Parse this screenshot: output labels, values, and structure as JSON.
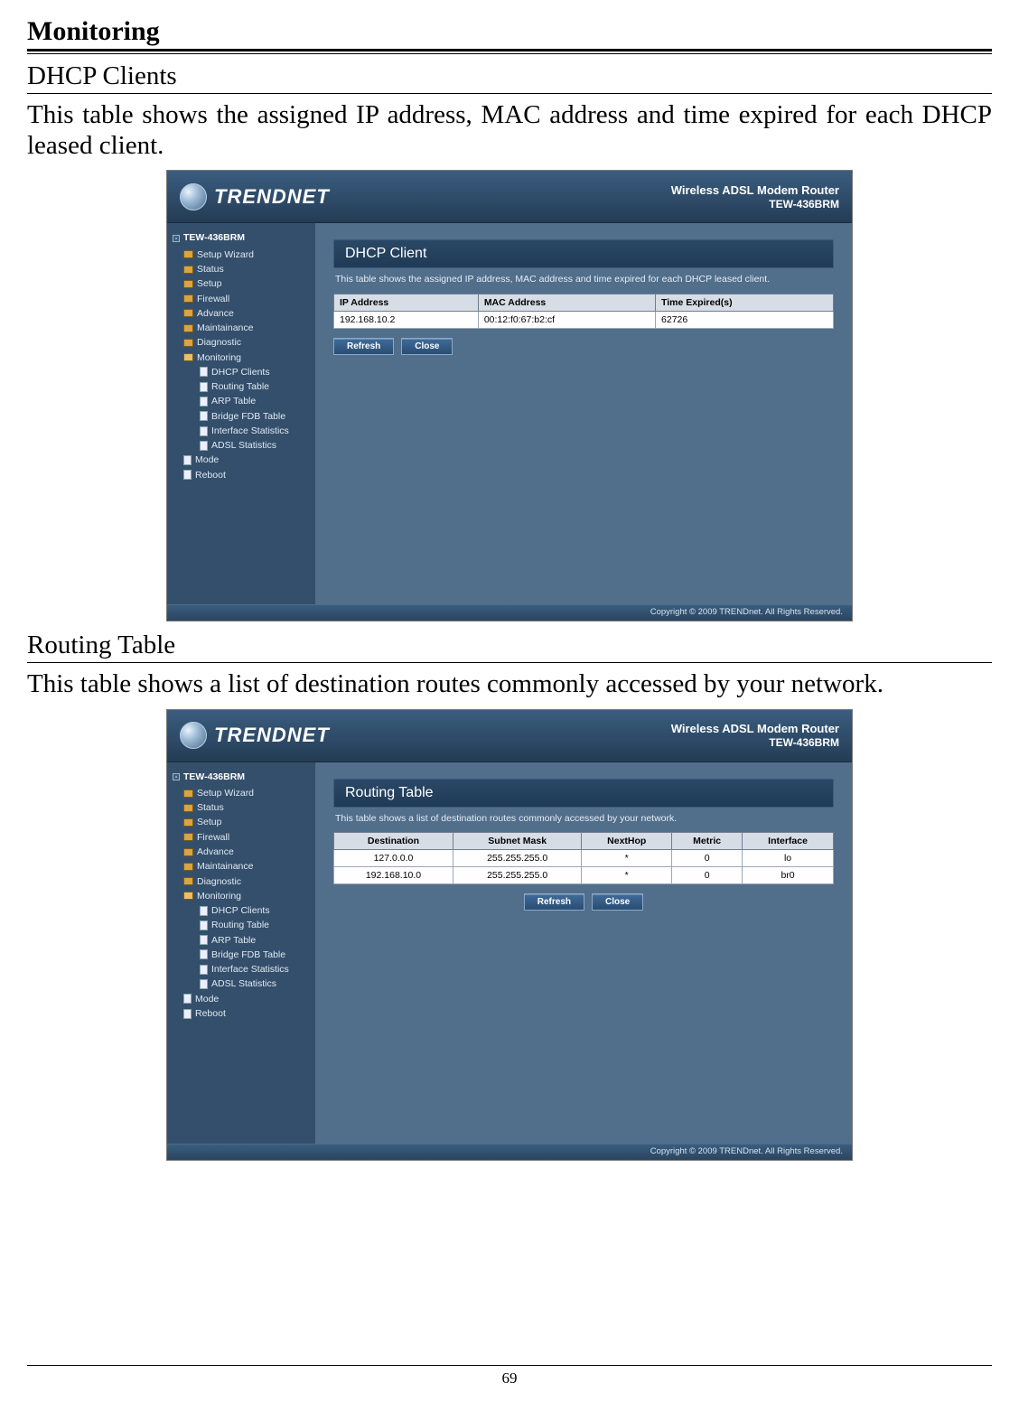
{
  "page": {
    "h1": "Monitoring",
    "section1_title": "DHCP Clients",
    "section1_body": "This table shows the assigned IP address, MAC address and time expired for each DHCP leased client.",
    "section2_title": "Routing Table",
    "section2_body": "This table shows a list of destination routes commonly accessed by your network.",
    "page_number": "69"
  },
  "router": {
    "brand": "TRENDNET",
    "product_line1": "Wireless ADSL Modem Router",
    "product_line2": "TEW-436BRM",
    "copyright": "Copyright © 2009 TRENDnet. All Rights Reserved.",
    "nav": {
      "root": "TEW-436BRM",
      "items": [
        "Setup Wizard",
        "Status",
        "Setup",
        "Firewall",
        "Advance",
        "Maintainance",
        "Diagnostic",
        "Monitoring"
      ],
      "monitoring_children": [
        "DHCP Clients",
        "Routing Table",
        "ARP Table",
        "Bridge FDB Table",
        "Interface Statistics",
        "ADSL Statistics"
      ],
      "tail": [
        "Mode",
        "Reboot"
      ]
    },
    "buttons": {
      "refresh": "Refresh",
      "close": "Close"
    }
  },
  "dhcp": {
    "panel_title": "DHCP Client",
    "panel_desc": "This table shows the assigned IP address, MAC address and time expired for each DHCP leased client.",
    "headers": [
      "IP Address",
      "MAC Address",
      "Time Expired(s)"
    ],
    "rows": [
      [
        "192.168.10.2",
        "00:12:f0:67:b2:cf",
        "62726"
      ]
    ]
  },
  "routing": {
    "panel_title": "Routing Table",
    "panel_desc": "This table shows a list of destination routes commonly accessed by your network.",
    "headers": [
      "Destination",
      "Subnet Mask",
      "NextHop",
      "Metric",
      "Interface"
    ],
    "rows": [
      [
        "127.0.0.0",
        "255.255.255.0",
        "*",
        "0",
        "lo"
      ],
      [
        "192.168.10.0",
        "255.255.255.0",
        "*",
        "0",
        "br0"
      ]
    ]
  }
}
